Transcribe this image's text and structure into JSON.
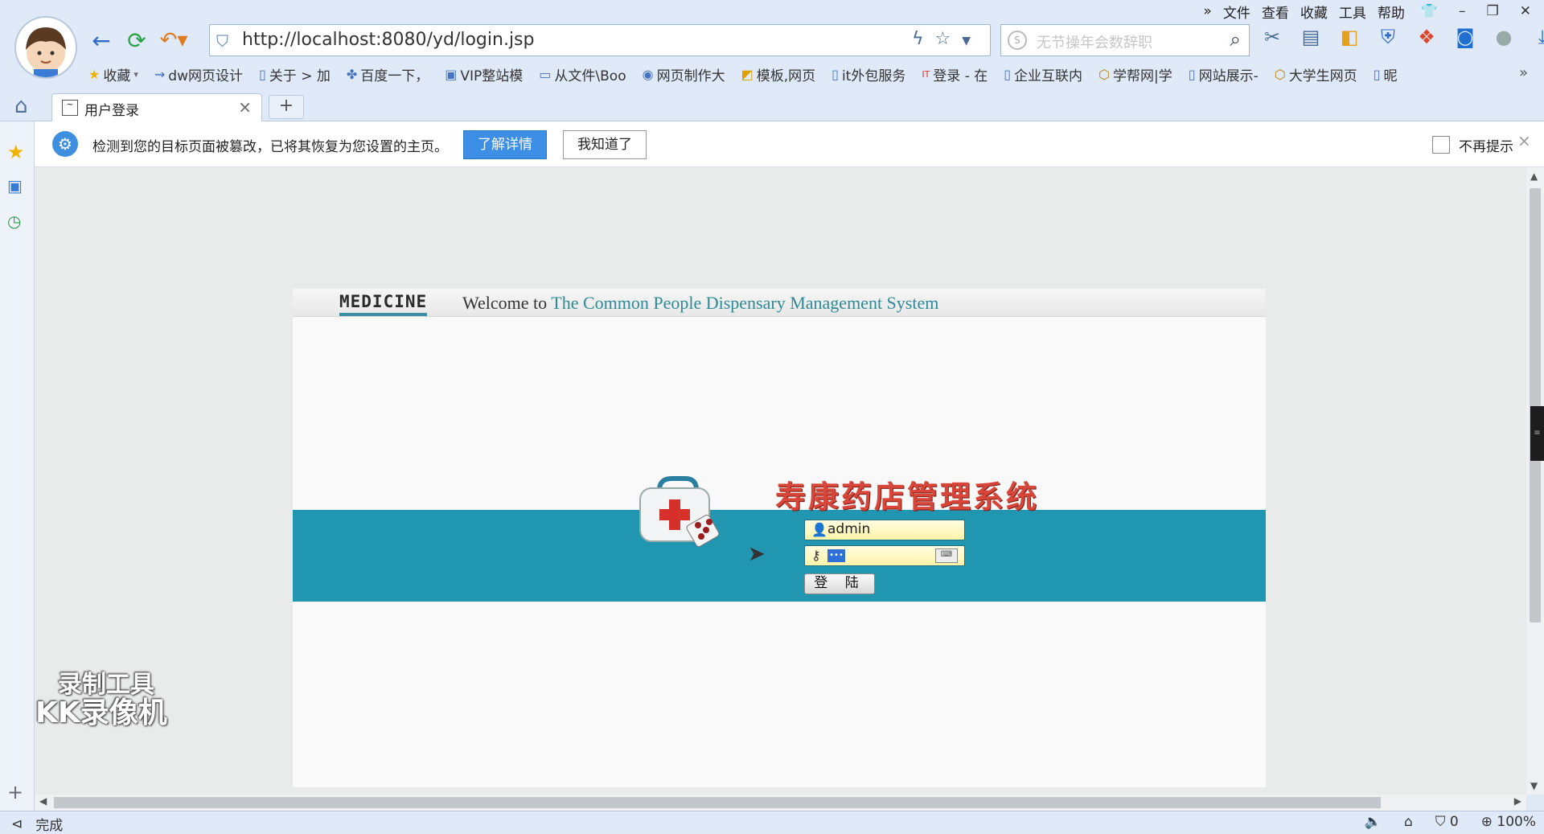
{
  "menu": {
    "items": [
      "文件",
      "查看",
      "收藏",
      "工具",
      "帮助"
    ],
    "expand": "»"
  },
  "address_bar": {
    "url": "http://localhost:8080/yd/login.jsp"
  },
  "search_box": {
    "placeholder": "无节操年会数辞职"
  },
  "bookmarks": [
    "收藏",
    "dw网页设计",
    "关于 > 加",
    "百度一下，",
    "VIP整站模",
    "从文件\\Boo",
    "网页制作大",
    "模板,网页",
    "it外包服务",
    "登录 - 在",
    "企业互联内",
    "学帮网|学",
    "网站展示-",
    "大学生网页",
    "昵"
  ],
  "tab": {
    "title": "用户登录"
  },
  "notice": {
    "message": "检测到您的目标页面被篡改，已将其恢复为您设置的主页。",
    "details_button": "了解详情",
    "ok_button": "我知道了",
    "dont_show": "不再提示"
  },
  "page": {
    "logo": "MEDICINE",
    "welcome_prefix": "Welcome to",
    "welcome_highlight": "The Common People Dispensary Management System",
    "system_title": "寿康药店管理系统",
    "username_value": "admin",
    "password_mask": "•••",
    "login_button": "登 陆"
  },
  "watermark": {
    "line1": "录制工具",
    "line2": "KK录像机"
  },
  "status_bar": {
    "status": "完成",
    "counter": "0",
    "zoom": "100%"
  },
  "colors": {
    "band": "#2096b1",
    "title_red": "#d8463a",
    "accent_blue": "#3d8fe5"
  }
}
